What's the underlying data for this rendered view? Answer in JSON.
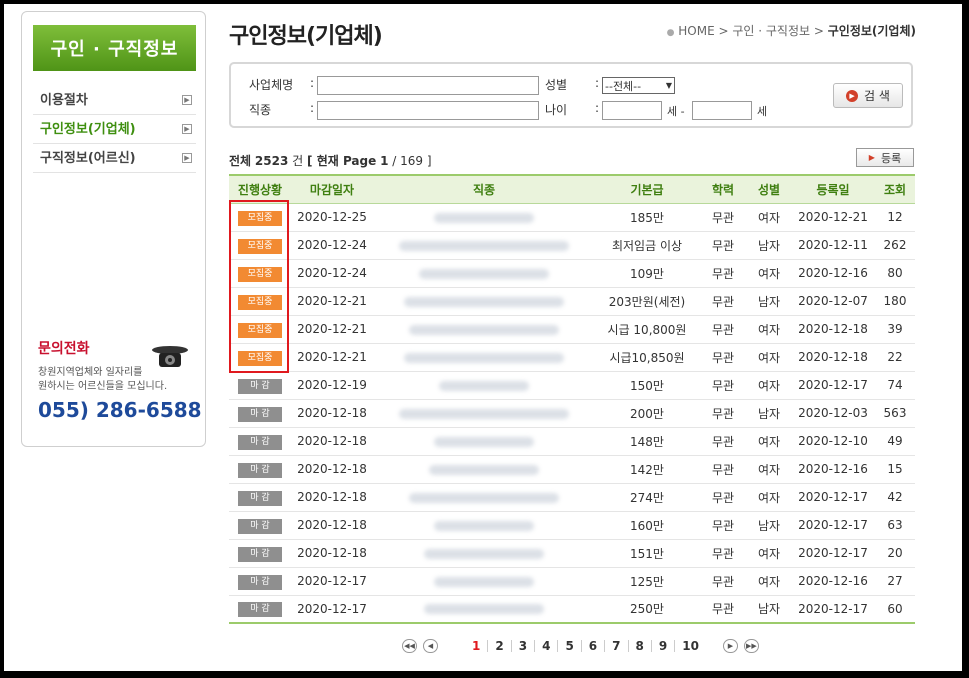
{
  "sidebar": {
    "title": "구인 · 구직정보",
    "items": [
      {
        "label": "이용절차"
      },
      {
        "label": "구인정보(기업체)"
      },
      {
        "label": "구직정보(어르신)"
      }
    ],
    "contact": {
      "title": "문의전화",
      "desc_line1": "창원지역업체와 일자리를",
      "desc_line2": "원하시는 어르신들을 모십니다.",
      "phone": "055) 286-6588"
    }
  },
  "page": {
    "title": "구인정보(기업체)",
    "breadcrumb": [
      "HOME",
      "구인 · 구직정보",
      "구인정보(기업체)"
    ]
  },
  "search": {
    "company_label": "사업체명",
    "job_label": "직종",
    "gender_label": "성별",
    "age_label": "나이",
    "colon": ":",
    "gender_value": "--전체--",
    "age_unit": "세",
    "age_sep": "세 -",
    "button": "검 색"
  },
  "summary": {
    "prefix": "전체",
    "total": "2523",
    "unit": "건",
    "page_label": "[ 현재 Page",
    "current_page": "1",
    "total_pages": "/ 169 ]",
    "register": "등록"
  },
  "table": {
    "headers": [
      "진행상황",
      "마감일자",
      "직종",
      "기본급",
      "학력",
      "성별",
      "등록일",
      "조회"
    ],
    "rows": [
      {
        "status": "모집중",
        "deadline": "2020-12-25",
        "salary": "185만",
        "edu": "무관",
        "gender": "여자",
        "date": "2020-12-21",
        "views": "12"
      },
      {
        "status": "모집중",
        "deadline": "2020-12-24",
        "salary": "최저임금 이상",
        "edu": "무관",
        "gender": "남자",
        "date": "2020-12-11",
        "views": "262"
      },
      {
        "status": "모집중",
        "deadline": "2020-12-24",
        "salary": "109만",
        "edu": "무관",
        "gender": "여자",
        "date": "2020-12-16",
        "views": "80"
      },
      {
        "status": "모집중",
        "deadline": "2020-12-21",
        "salary": "203만원(세전)",
        "edu": "무관",
        "gender": "남자",
        "date": "2020-12-07",
        "views": "180"
      },
      {
        "status": "모집중",
        "deadline": "2020-12-21",
        "salary": "시급 10,800원",
        "edu": "무관",
        "gender": "여자",
        "date": "2020-12-18",
        "views": "39"
      },
      {
        "status": "모집중",
        "deadline": "2020-12-21",
        "salary": "시급10,850원",
        "edu": "무관",
        "gender": "여자",
        "date": "2020-12-18",
        "views": "22"
      },
      {
        "status": "마 감",
        "deadline": "2020-12-19",
        "salary": "150만",
        "edu": "무관",
        "gender": "여자",
        "date": "2020-12-17",
        "views": "74"
      },
      {
        "status": "마 감",
        "deadline": "2020-12-18",
        "salary": "200만",
        "edu": "무관",
        "gender": "남자",
        "date": "2020-12-03",
        "views": "563"
      },
      {
        "status": "마 감",
        "deadline": "2020-12-18",
        "salary": "148만",
        "edu": "무관",
        "gender": "여자",
        "date": "2020-12-10",
        "views": "49"
      },
      {
        "status": "마 감",
        "deadline": "2020-12-18",
        "salary": "142만",
        "edu": "무관",
        "gender": "여자",
        "date": "2020-12-16",
        "views": "15"
      },
      {
        "status": "마 감",
        "deadline": "2020-12-18",
        "salary": "274만",
        "edu": "무관",
        "gender": "여자",
        "date": "2020-12-17",
        "views": "42"
      },
      {
        "status": "마 감",
        "deadline": "2020-12-18",
        "salary": "160만",
        "edu": "무관",
        "gender": "남자",
        "date": "2020-12-17",
        "views": "63"
      },
      {
        "status": "마 감",
        "deadline": "2020-12-18",
        "salary": "151만",
        "edu": "무관",
        "gender": "여자",
        "date": "2020-12-17",
        "views": "20"
      },
      {
        "status": "마 감",
        "deadline": "2020-12-17",
        "salary": "125만",
        "edu": "무관",
        "gender": "여자",
        "date": "2020-12-16",
        "views": "27"
      },
      {
        "status": "마 감",
        "deadline": "2020-12-17",
        "salary": "250만",
        "edu": "무관",
        "gender": "남자",
        "date": "2020-12-17",
        "views": "60"
      }
    ]
  },
  "pagination": {
    "pages": [
      "1",
      "2",
      "3",
      "4",
      "5",
      "6",
      "7",
      "8",
      "9",
      "10"
    ],
    "current": "1"
  },
  "colors": {
    "accent_green": "#4f9417",
    "open_badge": "#f28a32",
    "closed_badge": "#8f8f8f",
    "highlight_red": "#e0191e",
    "phone_blue": "#1e4a9a"
  }
}
